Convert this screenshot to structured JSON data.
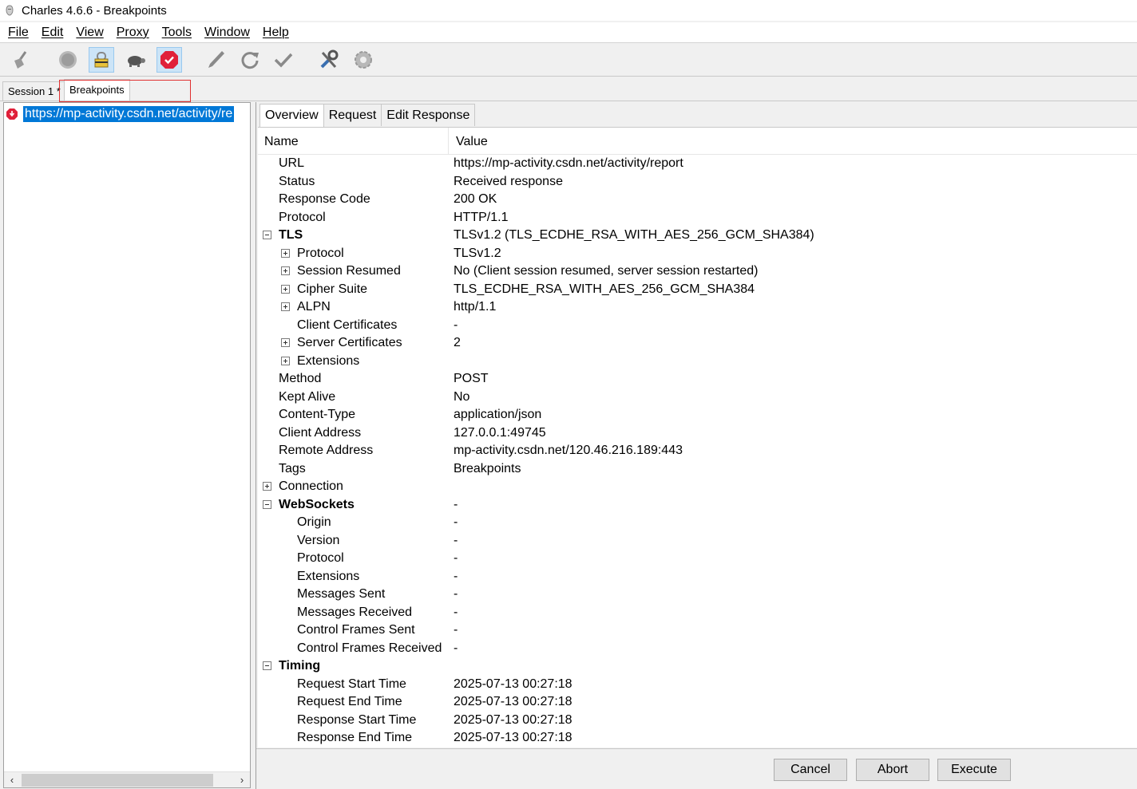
{
  "window": {
    "title": "Charles 4.6.6 - Breakpoints"
  },
  "menu": [
    "File",
    "Edit",
    "View",
    "Proxy",
    "Tools",
    "Window",
    "Help"
  ],
  "toolbar": {
    "icons": [
      "broom-icon",
      "record-icon",
      "ssl-proxy-icon",
      "throttle-turtle-icon",
      "breakpoints-icon",
      "compose-pen-icon",
      "repeat-icon",
      "validate-check-icon",
      "tools-icon",
      "settings-gear-icon"
    ]
  },
  "session_tabs": [
    {
      "label": "Session 1 *"
    },
    {
      "label": "Breakpoints"
    }
  ],
  "left": {
    "url": "https://mp-activity.csdn.net/activity/re"
  },
  "detail_tabs": [
    "Overview",
    "Request",
    "Edit Response"
  ],
  "table": {
    "headers": {
      "name": "Name",
      "value": "Value"
    },
    "rows": [
      {
        "name": "URL",
        "value": "https://mp-activity.csdn.net/activity/report"
      },
      {
        "name": "Status",
        "value": "Received response"
      },
      {
        "name": "Response Code",
        "value": "200 OK"
      },
      {
        "name": "Protocol",
        "value": "HTTP/1.1"
      },
      {
        "name": "TLS",
        "value": "TLSv1.2 (TLS_ECDHE_RSA_WITH_AES_256_GCM_SHA384)"
      },
      {
        "name": "Protocol",
        "value": "TLSv1.2"
      },
      {
        "name": "Session Resumed",
        "value": "No (Client session resumed, server session restarted)"
      },
      {
        "name": "Cipher Suite",
        "value": "TLS_ECDHE_RSA_WITH_AES_256_GCM_SHA384"
      },
      {
        "name": "ALPN",
        "value": "http/1.1"
      },
      {
        "name": "Client Certificates",
        "value": "-"
      },
      {
        "name": "Server Certificates",
        "value": "2"
      },
      {
        "name": "Extensions",
        "value": ""
      },
      {
        "name": "Method",
        "value": "POST"
      },
      {
        "name": "Kept Alive",
        "value": "No"
      },
      {
        "name": "Content-Type",
        "value": "application/json"
      },
      {
        "name": "Client Address",
        "value": "127.0.0.1:49745"
      },
      {
        "name": "Remote Address",
        "value": "mp-activity.csdn.net/120.46.216.189:443"
      },
      {
        "name": "Tags",
        "value": "Breakpoints"
      },
      {
        "name": "Connection",
        "value": ""
      },
      {
        "name": "WebSockets",
        "value": "-"
      },
      {
        "name": "Origin",
        "value": "-"
      },
      {
        "name": "Version",
        "value": "-"
      },
      {
        "name": "Protocol",
        "value": "-"
      },
      {
        "name": "Extensions",
        "value": "-"
      },
      {
        "name": "Messages Sent",
        "value": "-"
      },
      {
        "name": "Messages Received",
        "value": "-"
      },
      {
        "name": "Control Frames Sent",
        "value": "-"
      },
      {
        "name": "Control Frames Received",
        "value": "-"
      },
      {
        "name": "Timing",
        "value": ""
      },
      {
        "name": "Request Start Time",
        "value": "2025-07-13 00:27:18"
      },
      {
        "name": "Request End Time",
        "value": "2025-07-13 00:27:18"
      },
      {
        "name": "Response Start Time",
        "value": "2025-07-13 00:27:18"
      },
      {
        "name": "Response End Time",
        "value": "2025-07-13 00:27:18"
      }
    ]
  },
  "buttons": {
    "cancel": "Cancel",
    "abort": "Abort",
    "execute": "Execute"
  },
  "colors": {
    "selection": "#0078d7",
    "highlight_box": "#e03030",
    "breakpoint_red": "#e0203a"
  }
}
